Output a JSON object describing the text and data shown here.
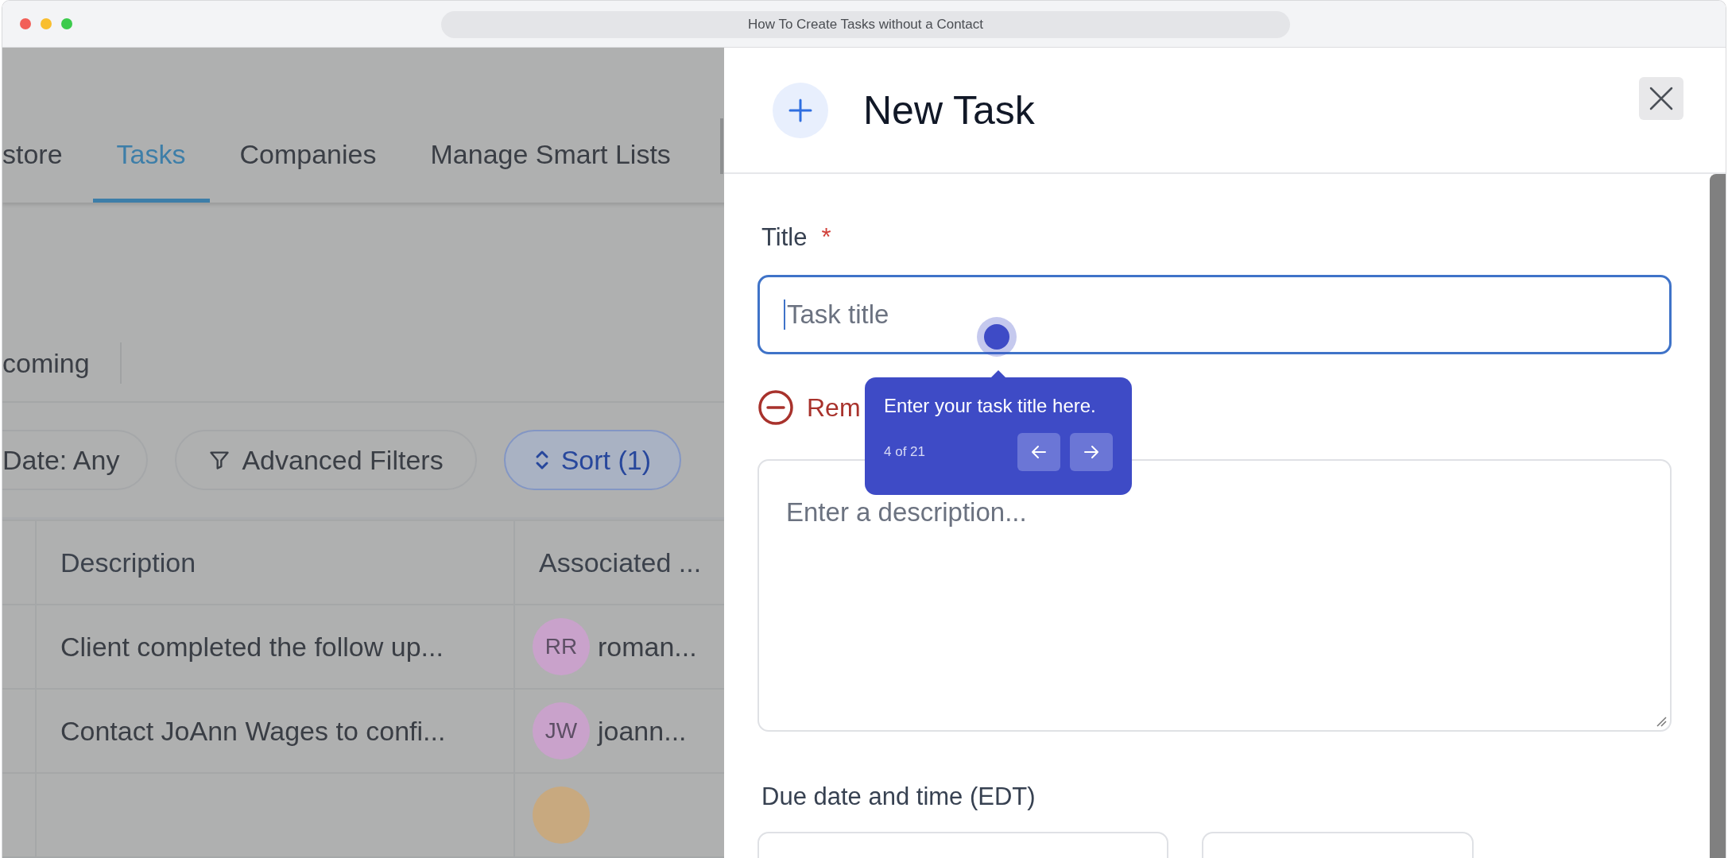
{
  "window": {
    "title": "How To Create Tasks without a Contact"
  },
  "tabs": [
    {
      "label": "store",
      "selected": false
    },
    {
      "label": "Tasks",
      "selected": true
    },
    {
      "label": "Companies",
      "selected": false
    },
    {
      "label": "Manage Smart Lists",
      "selected": false
    }
  ],
  "subtabs": [
    {
      "label": "coming"
    }
  ],
  "filters": [
    {
      "label": "Date: Any",
      "kind": "plain",
      "active": false
    },
    {
      "label": "Advanced Filters",
      "kind": "filter",
      "active": false
    },
    {
      "label": "Sort (1)",
      "kind": "sort",
      "active": true
    }
  ],
  "table": {
    "columns": [
      "Description",
      "Associated ..."
    ],
    "rows": [
      {
        "description": "Client completed the follow up...",
        "initials": "RR",
        "contact": "roman...",
        "color": "#c9a2cb"
      },
      {
        "description": "Contact JoAnn Wages to confi...",
        "initials": "JW",
        "contact": "joann...",
        "color": "#c9a2cb"
      },
      {
        "color": "#c8a97f"
      }
    ]
  },
  "task_panel": {
    "heading": "New Task",
    "title_label": "Title",
    "required_mark": "*",
    "title_placeholder": "Task title",
    "remove_label": "Rem",
    "description_placeholder": "Enter a description...",
    "due_label": "Due date and time (EDT)"
  },
  "tour": {
    "text": "Enter your task title here.",
    "step": "4 of 21"
  }
}
